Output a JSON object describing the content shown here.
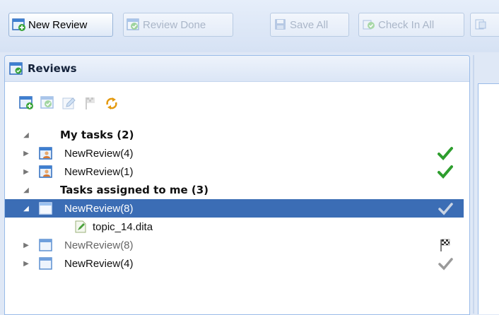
{
  "toolbar": {
    "new_review": "New Review",
    "review_done": "Review Done",
    "save_all": "Save All",
    "check_in_all": "Check In All"
  },
  "panel": {
    "title": "Reviews",
    "tool_icons": [
      "new-review-icon",
      "review-done-icon",
      "edit-icon",
      "flag-icon",
      "refresh-icon"
    ]
  },
  "tree": {
    "group_my_tasks": "My tasks (2)",
    "my_tasks": [
      {
        "label": "NewReview(4)",
        "status": "green-check-icon"
      },
      {
        "label": "NewReview(1)",
        "status": "green-check-icon"
      }
    ],
    "group_assigned": "Tasks assigned to me (3)",
    "assigned": [
      {
        "label": "NewReview(8)",
        "status": "grey-check-icon",
        "selected": true,
        "expanded": true
      },
      {
        "label": "topic_14.dita",
        "child": true
      },
      {
        "label": "NewReview(8)",
        "status": "checkered-flag-icon",
        "grey": true
      },
      {
        "label": "NewReview(4)",
        "status": "grey-check-icon"
      }
    ]
  },
  "colors": {
    "selection": "#3b6db5",
    "check_green": "#2e9e2e"
  }
}
